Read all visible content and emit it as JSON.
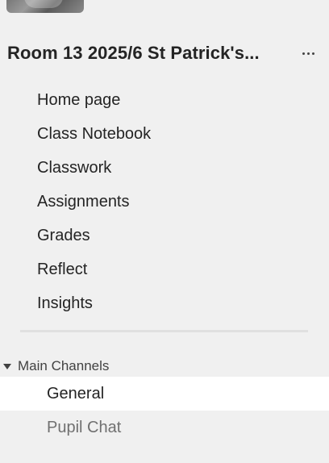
{
  "team": {
    "title": "Room 13 2025/6 St Patrick's...",
    "more_icon": "more-horizontal-icon"
  },
  "nav": {
    "items": [
      {
        "label": "Home page"
      },
      {
        "label": "Class Notebook"
      },
      {
        "label": "Classwork"
      },
      {
        "label": "Assignments"
      },
      {
        "label": "Grades"
      },
      {
        "label": "Reflect"
      },
      {
        "label": "Insights"
      }
    ]
  },
  "channels": {
    "header_label": "Main Channels",
    "caret_icon": "caret-down-icon",
    "items": [
      {
        "label": "General",
        "selected": true
      },
      {
        "label": "Pupil Chat",
        "selected": false
      }
    ]
  },
  "colors": {
    "background": "#f0f0f0",
    "selected_row": "#ffffff",
    "text": "#242424",
    "muted_text": "#707070",
    "divider": "#e0e0e0"
  }
}
